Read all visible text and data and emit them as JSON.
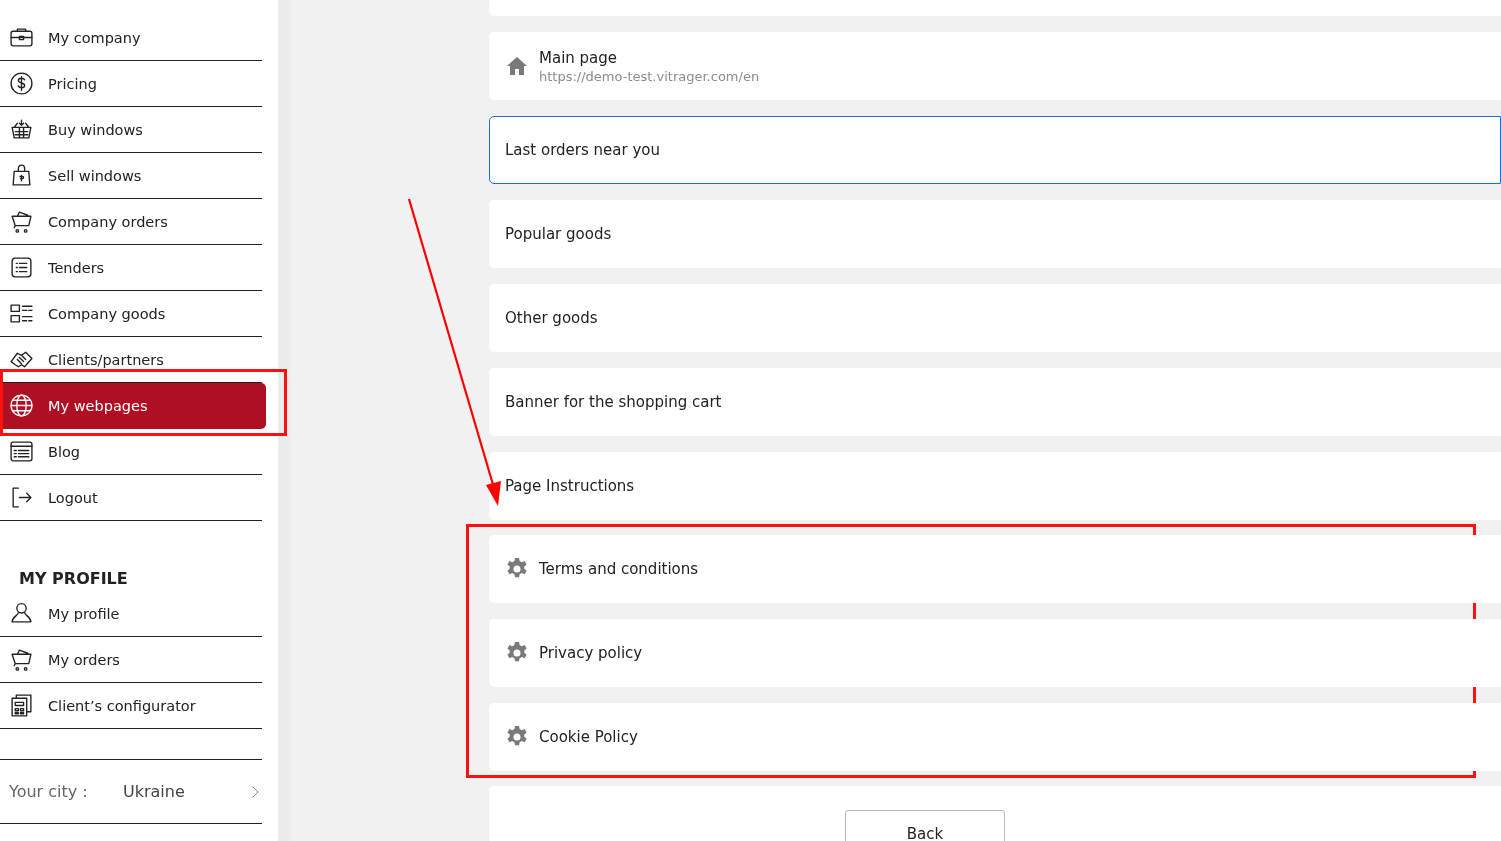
{
  "sidebar": {
    "items": [
      {
        "label": "My company",
        "selected": false,
        "outlined": false
      },
      {
        "label": "Pricing",
        "selected": false,
        "outlined": false
      },
      {
        "label": "Buy windows",
        "selected": false,
        "outlined": false
      },
      {
        "label": "Sell windows",
        "selected": false,
        "outlined": false
      },
      {
        "label": "Company orders",
        "selected": false,
        "outlined": false
      },
      {
        "label": "Tenders",
        "selected": false,
        "outlined": false
      },
      {
        "label": "Company goods",
        "selected": false,
        "outlined": false
      },
      {
        "label": "Clients/partners",
        "selected": false,
        "outlined": false
      },
      {
        "label": "My webpages",
        "selected": true,
        "outlined": true
      },
      {
        "label": "Blog",
        "selected": false,
        "outlined": false
      },
      {
        "label": "Logout",
        "selected": false,
        "outlined": false
      }
    ],
    "profile_heading": "MY PROFILE",
    "profile_items": [
      {
        "label": "My profile"
      },
      {
        "label": "My orders"
      },
      {
        "label": "Client’s configurator"
      }
    ],
    "city": {
      "label": "Your city :",
      "value": "Ukraine"
    }
  },
  "pages": [
    {
      "kind": "home",
      "title": "Main page",
      "url": "https://demo-test.vitrager.com/en",
      "selected": false,
      "outlined": false
    },
    {
      "kind": "plain",
      "title": "Last orders near you",
      "selected": true,
      "outlined": false
    },
    {
      "kind": "plain",
      "title": "Popular goods",
      "selected": false,
      "outlined": false
    },
    {
      "kind": "plain",
      "title": "Other goods",
      "selected": false,
      "outlined": false
    },
    {
      "kind": "plain",
      "title": "Banner for the shopping cart",
      "selected": false,
      "outlined": false
    },
    {
      "kind": "plain",
      "title": "Page Instructions",
      "selected": false,
      "outlined": false
    },
    {
      "kind": "settings",
      "title": "Terms and conditions",
      "selected": false,
      "outlined": true
    },
    {
      "kind": "settings",
      "title": "Privacy policy",
      "selected": false,
      "outlined": true
    },
    {
      "kind": "settings",
      "title": "Cookie Policy",
      "selected": false,
      "outlined": true
    }
  ],
  "annotation_arrow": true,
  "back_button": "Back"
}
